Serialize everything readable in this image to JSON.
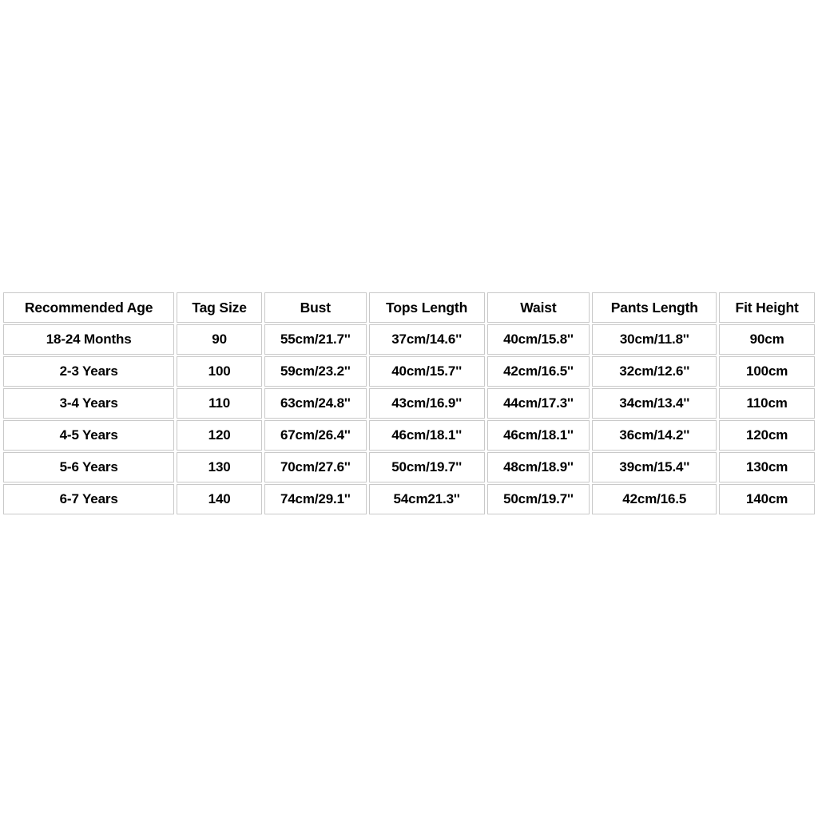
{
  "table": {
    "headers": [
      "Recommended Age",
      "Tag Size",
      "Bust",
      "Tops Length",
      "Waist",
      "Pants Length",
      "Fit Height"
    ],
    "rows": [
      {
        "recommended_age": "18-24 Months",
        "tag_size": "90",
        "bust": "55cm/21.7''",
        "tops_length": "37cm/14.6''",
        "waist": "40cm/15.8''",
        "pants_length": "30cm/11.8''",
        "fit_height": "90cm"
      },
      {
        "recommended_age": "2-3 Years",
        "tag_size": "100",
        "bust": "59cm/23.2''",
        "tops_length": "40cm/15.7''",
        "waist": "42cm/16.5''",
        "pants_length": "32cm/12.6''",
        "fit_height": "100cm"
      },
      {
        "recommended_age": "3-4 Years",
        "tag_size": "110",
        "bust": "63cm/24.8''",
        "tops_length": "43cm/16.9''",
        "waist": "44cm/17.3''",
        "pants_length": "34cm/13.4''",
        "fit_height": "110cm"
      },
      {
        "recommended_age": "4-5 Years",
        "tag_size": "120",
        "bust": "67cm/26.4''",
        "tops_length": "46cm/18.1''",
        "waist": "46cm/18.1''",
        "pants_length": "36cm/14.2''",
        "fit_height": "120cm"
      },
      {
        "recommended_age": "5-6 Years",
        "tag_size": "130",
        "bust": "70cm/27.6''",
        "tops_length": "50cm/19.7''",
        "waist": "48cm/18.9''",
        "pants_length": "39cm/15.4''",
        "fit_height": "130cm"
      },
      {
        "recommended_age": "6-7 Years",
        "tag_size": "140",
        "bust": "74cm/29.1''",
        "tops_length": "54cm21.3''",
        "waist": "50cm/19.7''",
        "pants_length": "42cm/16.5",
        "fit_height": "140cm"
      }
    ]
  },
  "colors": {
    "background": "#ffffff",
    "cell_background": "#ffffff",
    "cell_border": "#c9c9c9",
    "text": "#000000"
  }
}
